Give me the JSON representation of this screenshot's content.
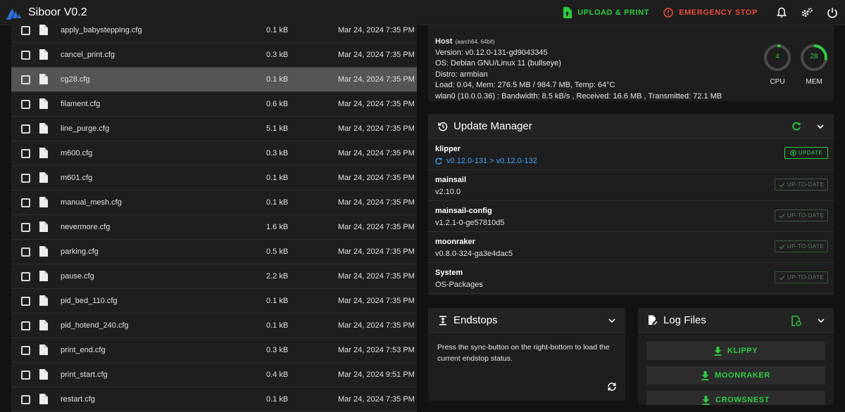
{
  "app": {
    "title": "Siboor V0.2"
  },
  "topbar": {
    "upload_label": "UPLOAD & PRINT",
    "estop_label": "EMERGENCY STOP"
  },
  "colors": {
    "accent": "#2ecc40",
    "danger": "#e74c3c",
    "link": "#42a5f5",
    "background": "#121212",
    "panel": "#1e1e1e"
  },
  "files": [
    {
      "name": "apply_babystepping.cfg",
      "size": "0.1 kB",
      "date": "Mar 24, 2024 7:35 PM",
      "selected": false
    },
    {
      "name": "cancel_print.cfg",
      "size": "0.3 kB",
      "date": "Mar 24, 2024 7:35 PM",
      "selected": false
    },
    {
      "name": "cg28.cfg",
      "size": "0.1 kB",
      "date": "Mar 24, 2024 7:35 PM",
      "selected": true
    },
    {
      "name": "filament.cfg",
      "size": "0.6 kB",
      "date": "Mar 24, 2024 7:35 PM",
      "selected": false
    },
    {
      "name": "line_purge.cfg",
      "size": "5.1 kB",
      "date": "Mar 24, 2024 7:35 PM",
      "selected": false
    },
    {
      "name": "m600.cfg",
      "size": "0.3 kB",
      "date": "Mar 24, 2024 7:35 PM",
      "selected": false
    },
    {
      "name": "m601.cfg",
      "size": "0.1 kB",
      "date": "Mar 24, 2024 7:35 PM",
      "selected": false
    },
    {
      "name": "manual_mesh.cfg",
      "size": "0.1 kB",
      "date": "Mar 24, 2024 7:35 PM",
      "selected": false
    },
    {
      "name": "nevermore.cfg",
      "size": "1.6 kB",
      "date": "Mar 24, 2024 7:35 PM",
      "selected": false
    },
    {
      "name": "parking.cfg",
      "size": "0.5 kB",
      "date": "Mar 24, 2024 7:35 PM",
      "selected": false
    },
    {
      "name": "pause.cfg",
      "size": "2.2 kB",
      "date": "Mar 24, 2024 7:35 PM",
      "selected": false
    },
    {
      "name": "pid_bed_110.cfg",
      "size": "0.1 kB",
      "date": "Mar 24, 2024 7:35 PM",
      "selected": false
    },
    {
      "name": "pid_hotend_240.cfg",
      "size": "0.1 kB",
      "date": "Mar 24, 2024 7:35 PM",
      "selected": false
    },
    {
      "name": "print_end.cfg",
      "size": "0.3 kB",
      "date": "Mar 24, 2024 7:53 PM",
      "selected": false
    },
    {
      "name": "print_start.cfg",
      "size": "0.4 kB",
      "date": "Mar 24, 2024 9:51 PM",
      "selected": false
    },
    {
      "name": "restart.cfg",
      "size": "0.1 kB",
      "date": "Mar 24, 2024 7:35 PM",
      "selected": false
    }
  ],
  "host": {
    "title": "Host",
    "arch": "(aarch64, 64bit)",
    "version": "Version: v0.12.0-131-gd9043345",
    "os": "OS: Debian GNU/Linux 11 (bullseye)",
    "distro": "Distro: armbian",
    "load": "Load: 0.04, Mem: 276.5 MB / 984.7 MB, Temp: 64°C",
    "network": "wlan0 (10.0.0.36) : Bandwidth: 8.5 kB/s , Received: 16.6 MB , Transmitted: 72.1 MB",
    "cpu": {
      "label": "CPU",
      "value": "4",
      "fraction": 0.04
    },
    "mem": {
      "label": "MEM",
      "value": "28",
      "fraction": 0.28
    }
  },
  "update_manager": {
    "title": "Update Manager",
    "entries": [
      {
        "name": "klipper",
        "version": "v0.12.0-131 > v0.12.0-132",
        "status": "UPDATE",
        "update_available": true
      },
      {
        "name": "mainsail",
        "version": "v2.10.0",
        "status": "UP-TO-DATE",
        "update_available": false
      },
      {
        "name": "mainsail-config",
        "version": "v1.2.1-0-ge57810d5",
        "status": "UP-TO-DATE",
        "update_available": false
      },
      {
        "name": "moonraker",
        "version": "v0.8.0-324-ga3e4dac5",
        "status": "UP-TO-DATE",
        "update_available": false
      },
      {
        "name": "System",
        "version": "OS-Packages",
        "status": "UP-TO-DATE",
        "update_available": false
      }
    ]
  },
  "endstops": {
    "title": "Endstops",
    "message": "Press the sync-button on the right-bottom to load the current endstop status."
  },
  "log_files": {
    "title": "Log Files",
    "buttons": [
      "KLIPPY",
      "MOONRAKER",
      "CROWSNEST"
    ]
  }
}
